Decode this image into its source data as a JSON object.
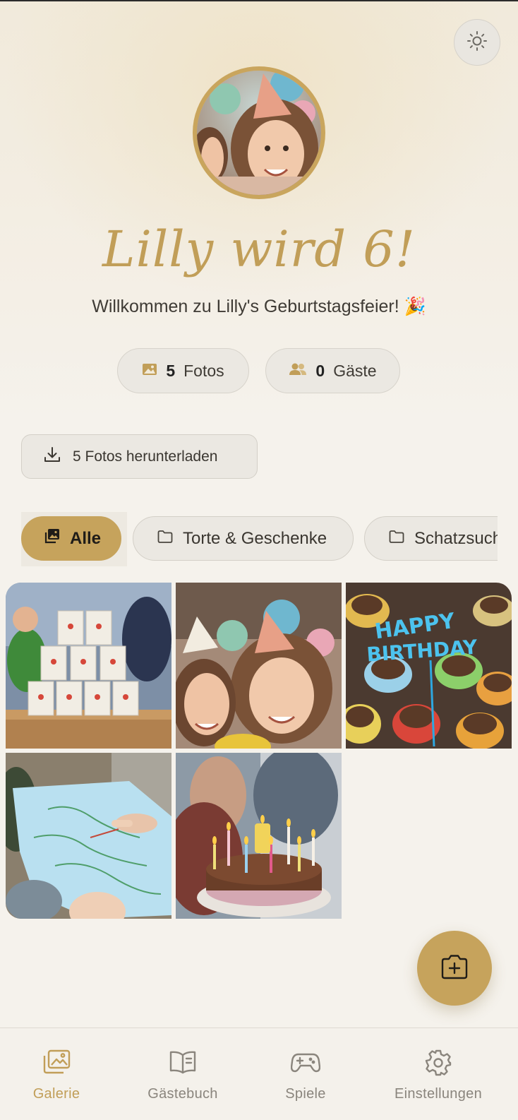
{
  "colors": {
    "accent": "#c6a35c",
    "title_gold": "#c19e58",
    "background": "#f5f2ec",
    "pill_bg": "#ebe8e2",
    "muted_text": "#8a857d"
  },
  "header": {
    "theme_toggle_icon": "sun-icon",
    "avatar_alt": "avatar-photo",
    "title": "Lilly wird 6!",
    "subtitle": "Willkommen zu Lilly's Geburtstagsfeier! 🎉"
  },
  "stats": {
    "photos": {
      "icon": "image-icon",
      "count": "5",
      "label": "Fotos"
    },
    "guests": {
      "icon": "users-icon",
      "count": "0",
      "label": "Gäste"
    }
  },
  "download": {
    "icon": "download-icon",
    "label": "5 Fotos herunterladen"
  },
  "categories": [
    {
      "icon": "images-icon",
      "label": "Alle",
      "active": true
    },
    {
      "icon": "folder-icon",
      "label": "Torte & Geschenke",
      "active": false
    },
    {
      "icon": "folder-icon",
      "label": "Schatzsuche",
      "active": false
    }
  ],
  "photos": [
    {
      "name": "photo-tin-can-game"
    },
    {
      "name": "photo-girls-party-hats"
    },
    {
      "name": "photo-birthday-muffins"
    },
    {
      "name": "photo-treasure-map"
    },
    {
      "name": "photo-birthday-cake"
    }
  ],
  "fab": {
    "icon": "add-photo-icon"
  },
  "nav": [
    {
      "icon": "gallery-icon",
      "label": "Galerie",
      "active": true
    },
    {
      "icon": "book-icon",
      "label": "Gästebuch",
      "active": false
    },
    {
      "icon": "gamepad-icon",
      "label": "Spiele",
      "active": false
    },
    {
      "icon": "gear-icon",
      "label": "Einstellungen",
      "active": false
    }
  ]
}
